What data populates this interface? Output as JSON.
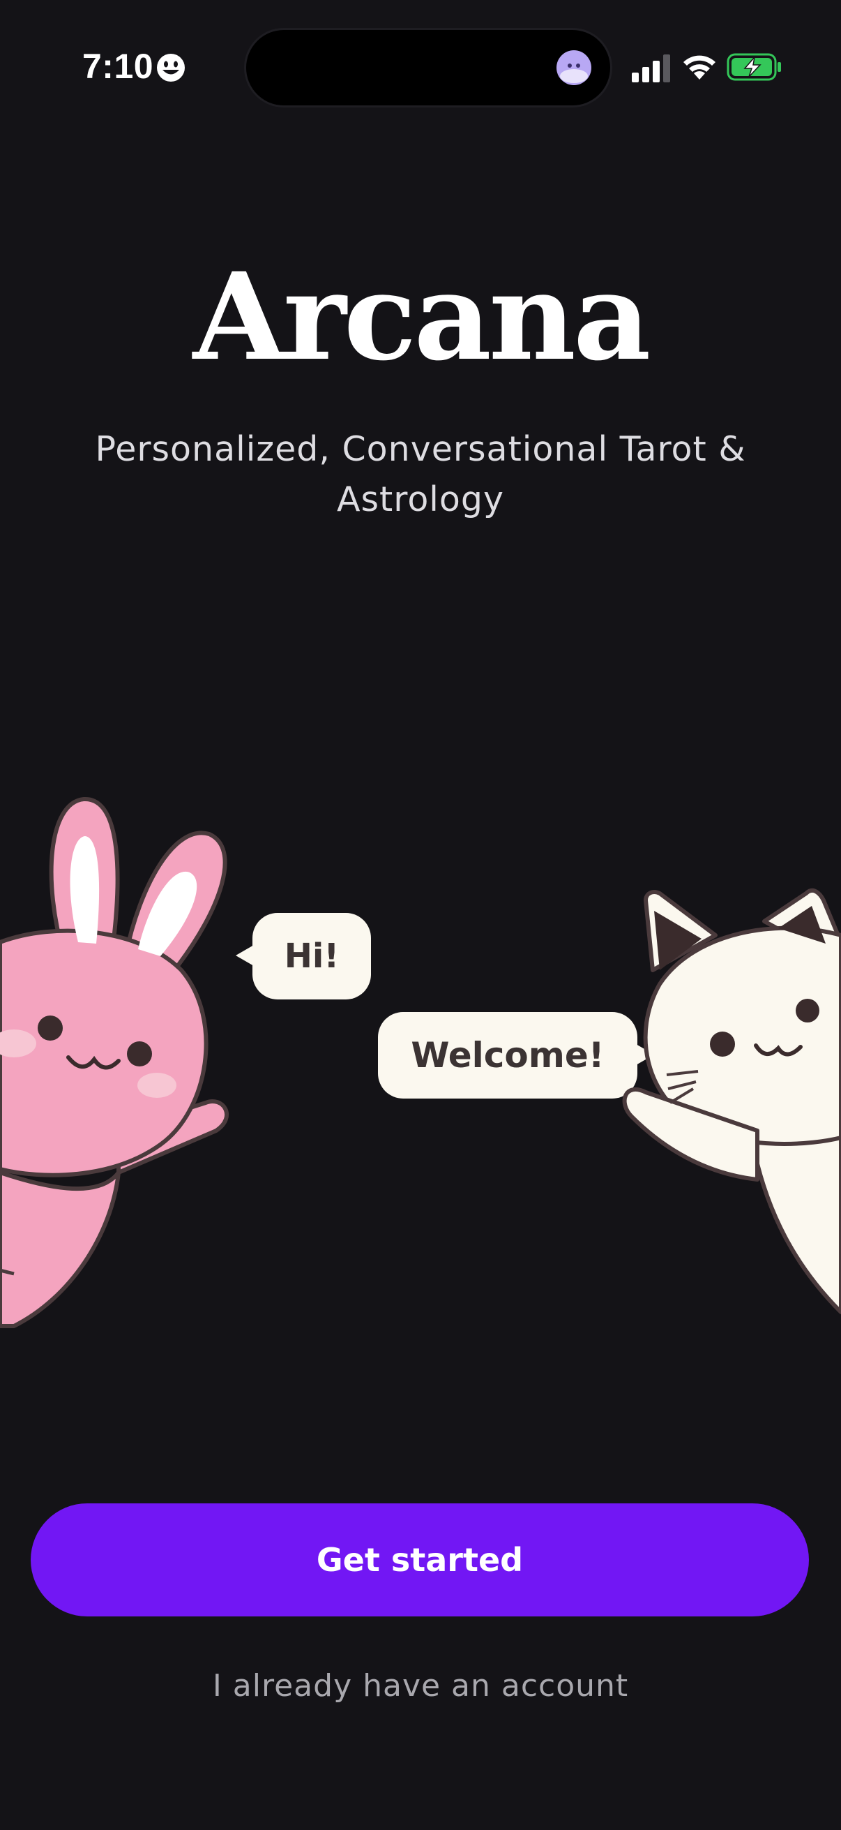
{
  "status_bar": {
    "time": "7:10",
    "icons": [
      "smiley-icon",
      "assistant-avatar-icon",
      "cellular-signal-icon",
      "wifi-icon",
      "battery-charging-icon"
    ]
  },
  "app": {
    "title": "Arcana",
    "subtitle": "Personalized, Conversational Tarot & Astrology"
  },
  "illustration": {
    "bunny_speech": "Hi!",
    "cat_speech": "Welcome!"
  },
  "actions": {
    "primary_label": "Get started",
    "secondary_label": "I already have an account"
  },
  "colors": {
    "background": "#141317",
    "accent": "#7217f4",
    "bunny": "#f4a4bf",
    "cat": "#fbf8ef",
    "battery": "#34c759"
  }
}
